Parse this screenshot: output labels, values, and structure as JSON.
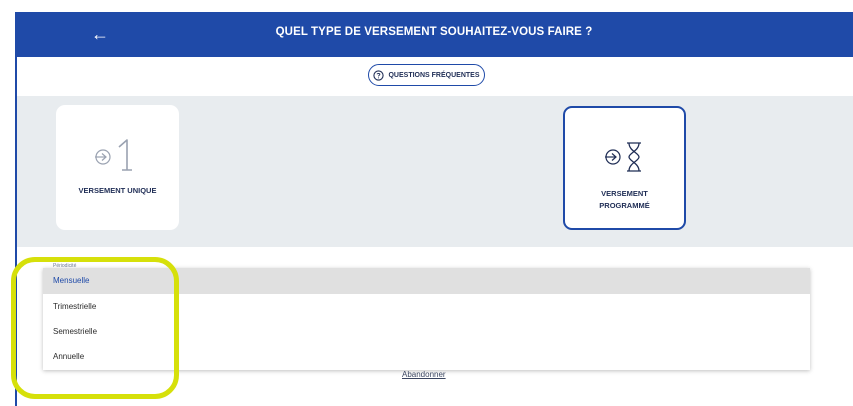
{
  "header": {
    "back_glyph": "←",
    "title": "QUEL TYPE DE VERSEMENT SOUHAITEZ-VOUS FAIRE ?",
    "background_color": "#1f4aa8"
  },
  "faq": {
    "icon": "question-circle-icon",
    "label": "QUESTIONS FRÉQUENTES"
  },
  "options": [
    {
      "label": "VERSEMENT UNIQUE",
      "icon": "arrow-in-one-icon",
      "selected": false
    },
    {
      "label_line1": "VERSEMENT",
      "label_line2": "PROGRAMMÉ",
      "icon": "arrow-in-hourglass-icon",
      "selected": true
    }
  ],
  "frequency": {
    "field_label": "Périodicité",
    "selected": "Mensuelle",
    "items": [
      "Mensuelle",
      "Trimestrielle",
      "Semestrielle",
      "Annuelle"
    ]
  },
  "footer": {
    "abandon_label": "Abandonner"
  },
  "colors": {
    "accent": "#1f4aa8",
    "highlight": "#d6e00a",
    "band": "#e8ecef"
  }
}
